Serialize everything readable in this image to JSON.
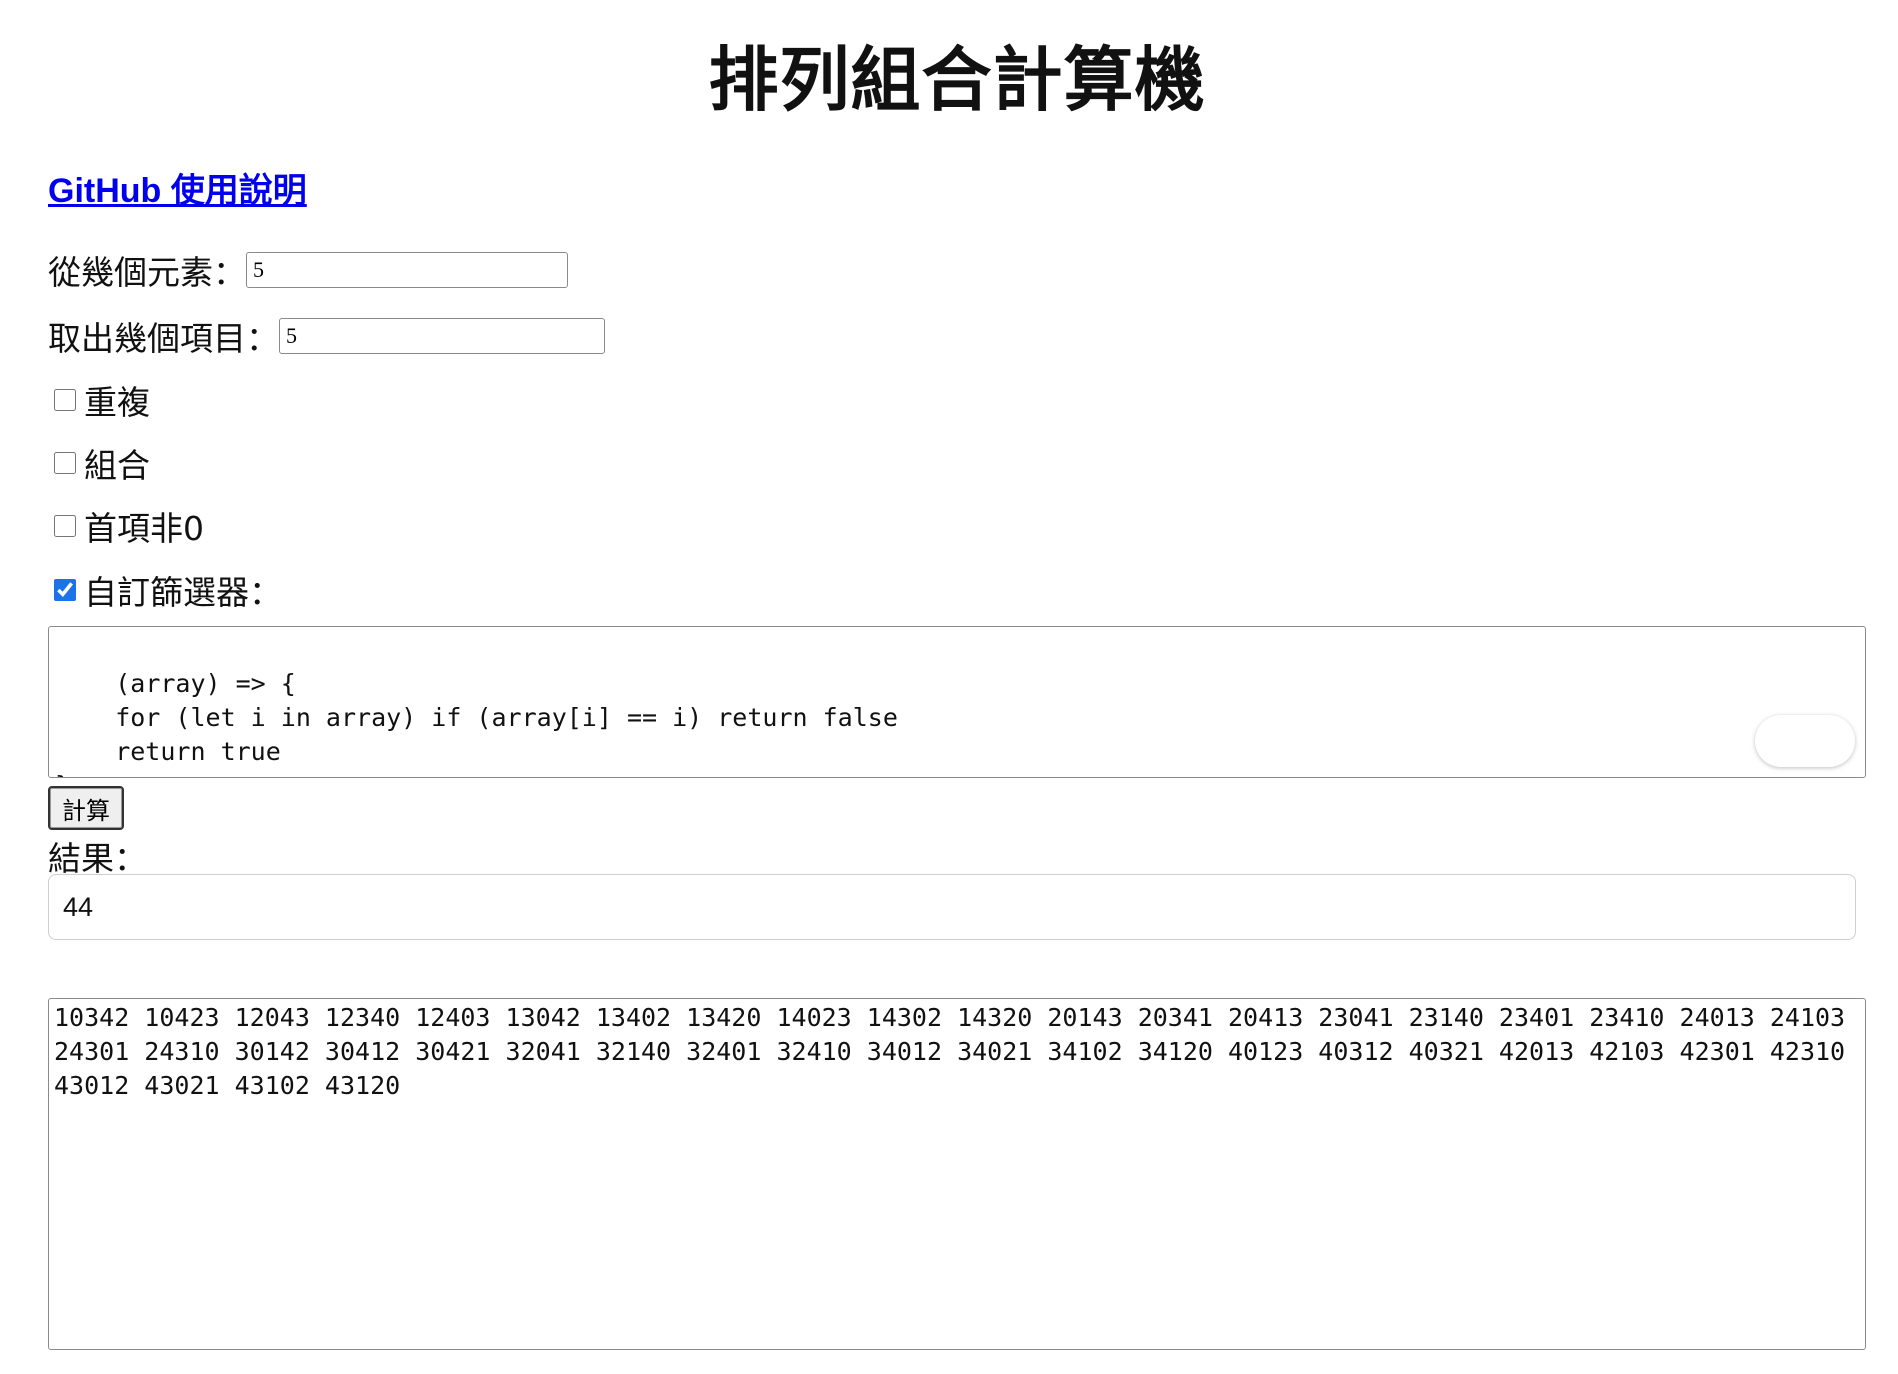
{
  "title": "排列組合計算機",
  "link": {
    "label": "GitHub 使用說明"
  },
  "fields": {
    "elements_label": "從幾個元素：",
    "elements_value": "5",
    "items_label": "取出幾個項目：",
    "items_value": "5"
  },
  "options": {
    "repeat_label": "重複",
    "repeat_checked": false,
    "combination_label": "組合",
    "combination_checked": false,
    "nonzero_first_label": "首項非0",
    "nonzero_first_checked": false,
    "custom_filter_label": "自訂篩選器：",
    "custom_filter_checked": true
  },
  "filter_code": "(array) => {\n    for (let i in array) if (array[i] == i) return false\n    return true\n}",
  "calc_button_label": "計算",
  "result": {
    "label": "結果：",
    "count": "44"
  },
  "output": "10342 10423 12043 12340 12403 13042 13402 13420 14023 14302 14320 20143 20341 20413 23041 23140 23401 23410 24013 24103 24301 24310 30142 30412 30421 32041 32140 32401 32410 34012 34021 34102 34120 40123 40312 40321 42013 42103 42301 42310 43012 43021 43102 43120",
  "icons": [
    "lightbulb-icon",
    "grammarly-icon",
    "resize-grip-icon"
  ],
  "colors": {
    "link": "#0000ee",
    "checkbox_accent": "#1a73e8",
    "grammarly_green": "#15c39a"
  }
}
